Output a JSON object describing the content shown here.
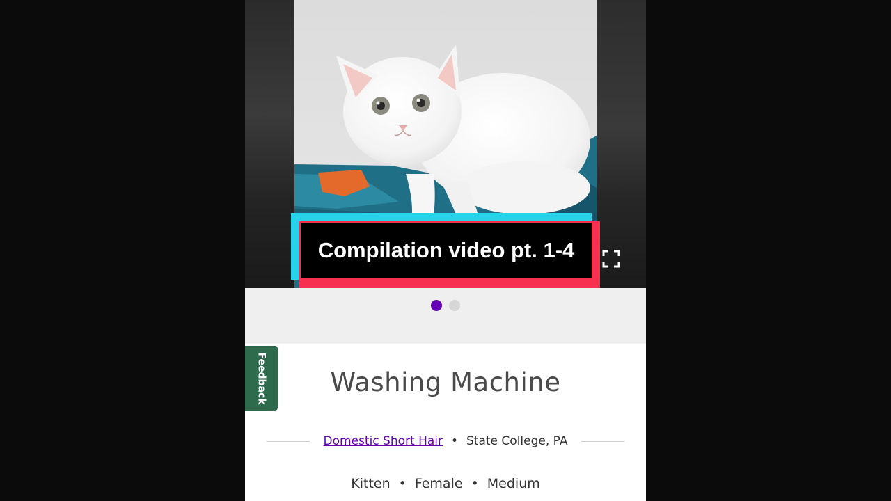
{
  "video_caption": "Compilation video pt. 1-4",
  "carousel": {
    "slide_count": 2,
    "active_slide": 1
  },
  "feedback": {
    "label": "Feedback"
  },
  "pet": {
    "name": "Washing Machine",
    "breed": "Domestic Short Hair",
    "location": "State College, PA",
    "age": "Kitten",
    "sex": "Female",
    "size": "Medium"
  },
  "separator": "•",
  "colors": {
    "accent_purple": "#6504b5",
    "feedback_green": "#2e6b4d",
    "caption_cyan": "#26d3ea",
    "caption_red": "#f7304f"
  },
  "icons": {
    "expand": "fullscreen-expand-icon"
  }
}
